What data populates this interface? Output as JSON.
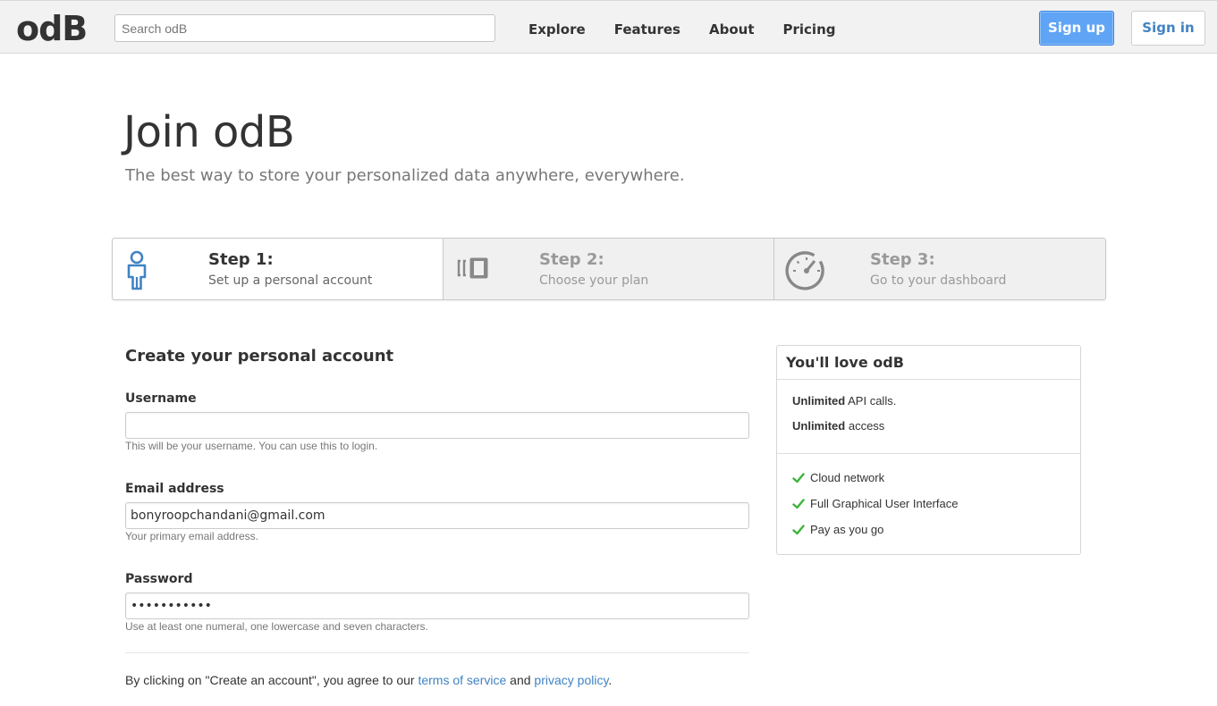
{
  "header": {
    "logo": "odB",
    "search_placeholder": "Search odB",
    "nav": [
      "Explore",
      "Features",
      "About",
      "Pricing"
    ],
    "signup_label": "Sign up",
    "signin_label": "Sign in"
  },
  "hero": {
    "title": "Join odB",
    "subtitle": "The best way to store your personalized data anywhere, everywhere."
  },
  "steps": [
    {
      "title": "Step 1:",
      "desc": "Set up a personal account",
      "icon": "person-icon",
      "active": true
    },
    {
      "title": "Step 2:",
      "desc": "Choose your plan",
      "icon": "plan-icon",
      "active": false
    },
    {
      "title": "Step 3:",
      "desc": "Go to your dashboard",
      "icon": "dashboard-gauge-icon",
      "active": false
    }
  ],
  "form": {
    "title": "Create your personal account",
    "username": {
      "label": "Username",
      "value": "",
      "note": "This will be your username. You can use this to login."
    },
    "email": {
      "label": "Email address",
      "value": "bonyroopchandani@gmail.com",
      "note": "Your primary email address."
    },
    "password": {
      "label": "Password",
      "value": "•••••••••••",
      "note": "Use at least one numeral, one lowercase and seven characters."
    },
    "terms": {
      "prefix": "By clicking on \"Create an account\", you agree to our ",
      "tos": "terms of service",
      "and": " and ",
      "privacy": "privacy policy",
      "suffix": "."
    }
  },
  "side": {
    "title": "You'll love odB",
    "unlimited": [
      {
        "bold": "Unlimited",
        "rest": " API calls."
      },
      {
        "bold": "Unlimited",
        "rest": " access"
      }
    ],
    "features": [
      "Cloud network",
      "Full Graphical User Interface",
      "Pay as you go"
    ]
  },
  "colors": {
    "accent": "#4183c4",
    "signup_bg": "#60a5f5",
    "check": "#3cb43c",
    "muted": "#999999"
  }
}
